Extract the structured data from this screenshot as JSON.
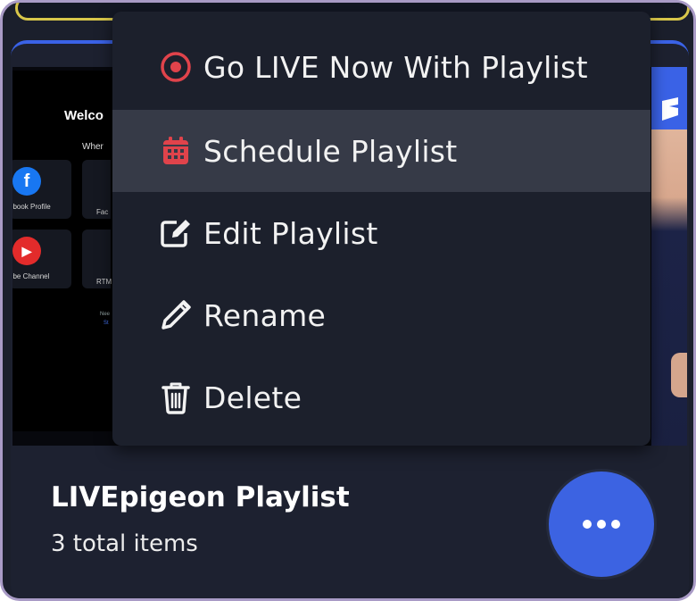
{
  "thumbnail": {
    "welcome_text": "Welco",
    "where_text": "Wher",
    "tiles": [
      {
        "icon": "facebook-icon",
        "label": "ebook Profile",
        "color": "#1877f2",
        "glyph": "f"
      },
      {
        "icon": "youtube-icon",
        "label": "ube Channel",
        "color": "#e32b2b",
        "glyph": "▶"
      }
    ],
    "tiles_partial": [
      "Fac",
      "RTM"
    ],
    "tiny_texts": [
      "Nee",
      "St"
    ]
  },
  "menu": {
    "items": [
      {
        "label": "Go LIVE Now With Playlist",
        "icon": "record-icon"
      },
      {
        "label": "Schedule Playlist",
        "icon": "calendar-icon",
        "active": true
      },
      {
        "label": "Edit Playlist",
        "icon": "edit-icon"
      },
      {
        "label": "Rename",
        "icon": "pencil-icon"
      },
      {
        "label": "Delete",
        "icon": "trash-icon"
      }
    ]
  },
  "playlist": {
    "title": "LIVEpigeon Playlist",
    "subtitle": "3 total items"
  },
  "colors": {
    "accent": "#3c63e2",
    "danger": "#e0434b",
    "menu_bg": "#1c202c",
    "menu_active_bg": "#363a47"
  }
}
